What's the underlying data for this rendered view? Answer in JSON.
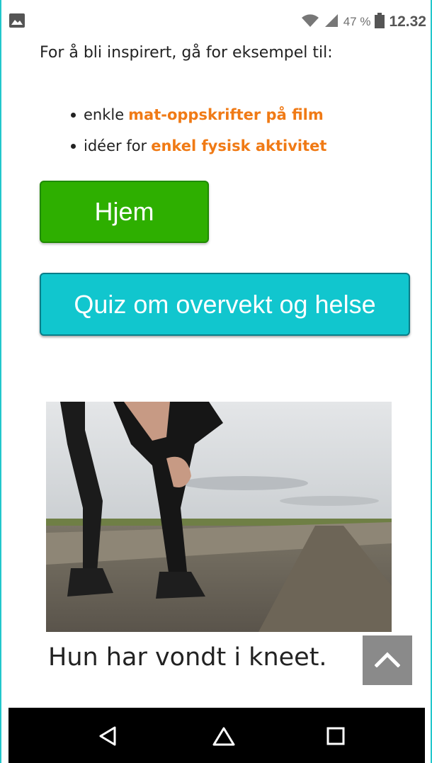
{
  "statusbar": {
    "battery": "47 %",
    "time": "12.32",
    "icons": [
      "image-icon",
      "wifi-icon",
      "signal-icon",
      "battery-icon"
    ]
  },
  "content": {
    "intro": "For å bli inspirert, gå for eksempel til:",
    "links": [
      {
        "prefix": "enkle",
        "link": "mat-oppskrifter på film"
      },
      {
        "prefix": "idéer for",
        "link": "enkel fysisk aktivitet"
      }
    ],
    "home_button": "Hjem",
    "quiz_button": "Quiz om overvekt og helse",
    "caption": "Hun har vondt i kneet."
  },
  "navigation": {
    "icons": [
      "back-icon",
      "home-icon",
      "recents-icon",
      "chevron-up-icon"
    ]
  },
  "colors": {
    "link": "#f07a15",
    "home_button": "#2eaf00",
    "quiz_button": "#11c6ce",
    "frame": "#22c7cc"
  }
}
